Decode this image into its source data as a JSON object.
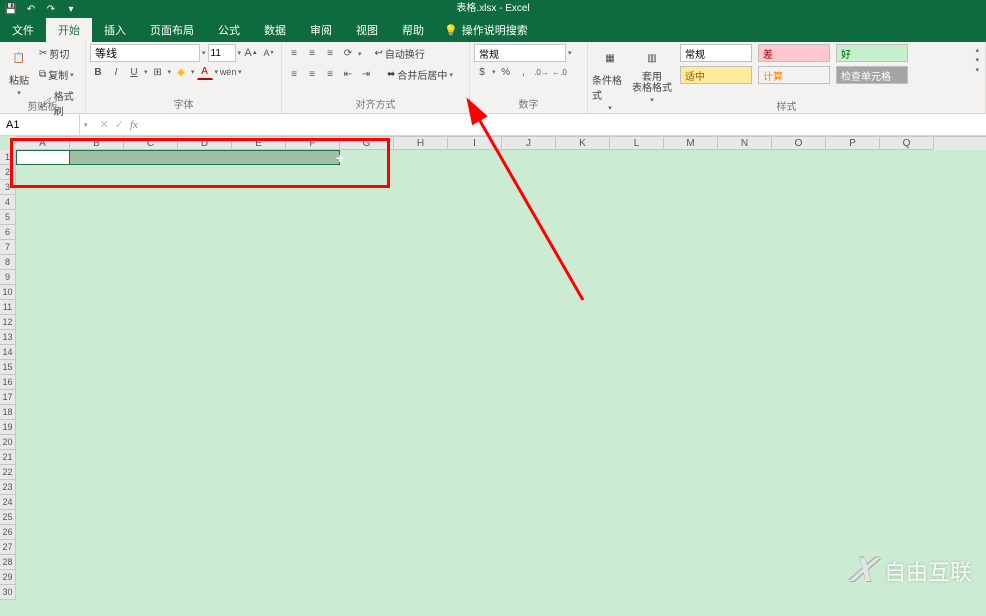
{
  "title": "表格.xlsx - Excel",
  "tabs": {
    "file": "文件",
    "home": "开始",
    "insert": "插入",
    "layout": "页面布局",
    "formula": "公式",
    "data": "数据",
    "review": "审阅",
    "view": "视图",
    "help": "帮助",
    "tell": "操作说明搜索"
  },
  "clipboard": {
    "paste": "粘贴",
    "cut": "剪切",
    "copy": "复制",
    "painter": "格式刷",
    "label": "剪贴板"
  },
  "font": {
    "name": "等线",
    "size": "11",
    "label": "字体"
  },
  "align": {
    "wrap": "自动换行",
    "merge": "合并后居中",
    "label": "对齐方式"
  },
  "number": {
    "fmt": "常规",
    "label": "数字"
  },
  "styles": {
    "cf": "条件格式",
    "tf": "套用\n表格格式",
    "normal": "常规",
    "bad": "差",
    "good": "好",
    "neutral": "适中",
    "calc": "计算",
    "check": "检查单元格",
    "label": "样式"
  },
  "namebox": "A1",
  "cols": [
    "A",
    "B",
    "C",
    "D",
    "E",
    "F",
    "G",
    "H",
    "I",
    "J",
    "K",
    "L",
    "M",
    "N",
    "O",
    "P",
    "Q"
  ],
  "rows": [
    1,
    2,
    3,
    4,
    5,
    6,
    7,
    8,
    9,
    10,
    11,
    12,
    13,
    14,
    15,
    16,
    17,
    18,
    19,
    20,
    21,
    22,
    23,
    24,
    25,
    26,
    27,
    28,
    29,
    30
  ],
  "watermark": "自由互联"
}
